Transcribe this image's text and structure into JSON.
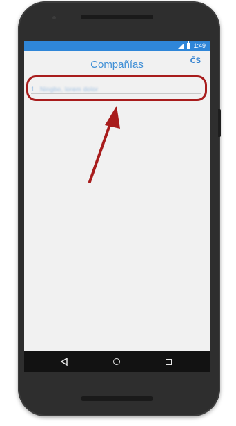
{
  "statusbar": {
    "time": "1:49"
  },
  "appbar": {
    "title": "Compañías",
    "action_label": "ČS"
  },
  "list": {
    "items": [
      {
        "number": "1.",
        "text": "Ningbo, lorem dolor"
      }
    ]
  },
  "colors": {
    "accent": "#2f86d8",
    "title": "#3f8fd6",
    "annotation": "#a81c1c"
  },
  "icons": [
    "signal-icon",
    "battery-icon",
    "back-icon",
    "home-icon",
    "recent-apps-icon"
  ]
}
